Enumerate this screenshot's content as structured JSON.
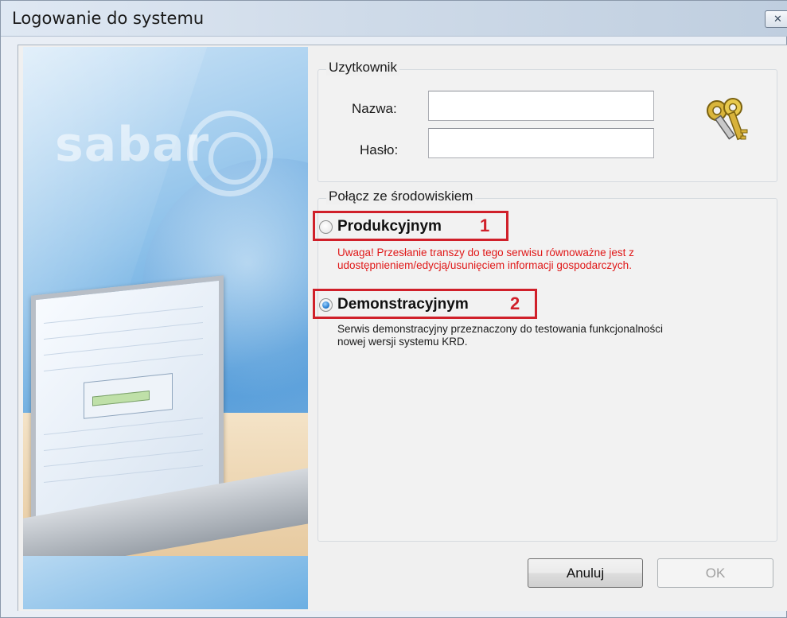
{
  "window": {
    "title": "Logowanie do systemu",
    "close_icon": "close-icon"
  },
  "branding": {
    "logo_text": "sabar"
  },
  "user_group": {
    "label": "Uzytkownik",
    "name_label": "Nazwa:",
    "name_value": "",
    "password_label": "Hasło:",
    "password_value": "",
    "icon": "keys-icon"
  },
  "env_group": {
    "label": "Połącz ze środowiskiem",
    "options": [
      {
        "label": "Produkcyjnym",
        "marker": "1",
        "checked": false,
        "note": "Uwaga! Przesłanie transzy do tego serwisu równoważne jest z udostępnieniem/edycją/usunięciem informacji gospodarczych.",
        "note_color": "#e01818"
      },
      {
        "label": "Demonstracyjnym",
        "marker": "2",
        "checked": true,
        "note": "Serwis demonstracyjny przeznaczony do testowania funkcjonalności nowej wersji systemu KRD."
      }
    ]
  },
  "buttons": {
    "cancel": "Anuluj",
    "ok": "OK"
  },
  "colors": {
    "highlight": "#d0202a",
    "warning": "#e01818",
    "radio_selected": "#1a73c9"
  }
}
